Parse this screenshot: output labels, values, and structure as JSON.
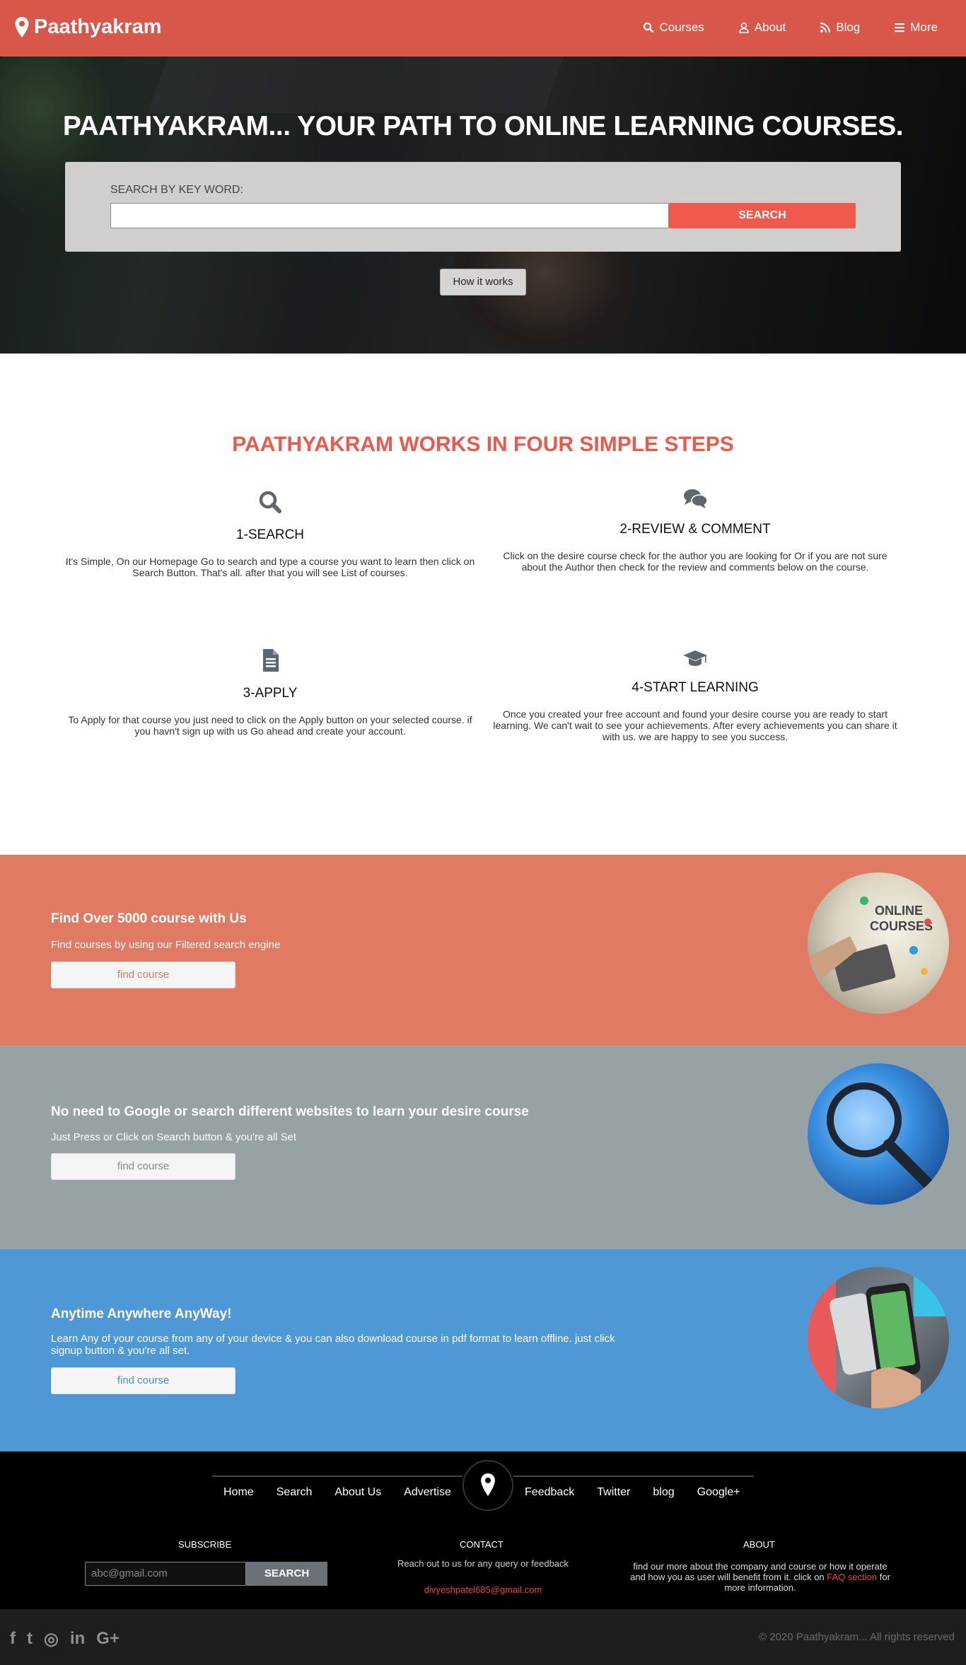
{
  "navbar": {
    "brand": "Paathyakram",
    "items": [
      {
        "label": "Courses",
        "icon": "search-icon"
      },
      {
        "label": "About",
        "icon": "user-icon"
      },
      {
        "label": "Blog",
        "icon": "rss-icon"
      },
      {
        "label": "More",
        "icon": "menu-icon"
      }
    ]
  },
  "hero": {
    "title": "PAATHYAKRAM... YOUR PATH TO ONLINE LEARNING COURSES.",
    "search_label": "SEARCH BY KEY WORD:",
    "search_value": "",
    "search_button": "SEARCH",
    "how_button": "How it works"
  },
  "steps": {
    "title": "PAATHYAKRAM WORKS IN FOUR SIMPLE STEPS",
    "items": [
      {
        "icon": "search-icon",
        "title": "1-SEARCH",
        "text": "It's Simple, On our Homepage Go to search and type a course you want to learn then click on Search Button. That's all. after that you will see List of courses."
      },
      {
        "icon": "comments-icon",
        "title": "2-REVIEW & COMMENT",
        "text": "Click on the desire course check for the author you are looking for Or if you are not sure about the Author then check for the review and comments below on the course."
      },
      {
        "icon": "document-icon",
        "title": "3-APPLY",
        "text": "To Apply for that course you just need to click on the Apply button on your selected course. if you havn't sign up with us Go ahead and create your account."
      },
      {
        "icon": "graduation-cap-icon",
        "title": "4-START LEARNING",
        "text": "Once you created your free account and found your desire course you are ready to start learning. We can't wait to see your achievements. After every achievements you can share it with us. we are happy to see you success."
      }
    ]
  },
  "bands": [
    {
      "title": "Find Over 5000 course with Us",
      "text": "Find courses by using our Filtered search engine",
      "button": "find course",
      "color": "#e07a62",
      "button_color": "#e07a62"
    },
    {
      "title": "No need to Google or search different websites to learn your desire course",
      "text": "Just Press or Click on Search button & you're all Set",
      "button": "find course",
      "color": "#96a2a3",
      "button_color": "#8a8a8a"
    },
    {
      "title": "Anytime Anywhere AnyWay!",
      "text": "Learn Any of your course from any of your device & you can also download course in pdf format to learn offline. just click signup button & you're all set.",
      "button": "find course",
      "color": "#4e98d6",
      "button_color": "#4e8fcb"
    }
  ],
  "footer": {
    "nav_left": [
      "Home",
      "Search",
      "About Us",
      "Advertise"
    ],
    "nav_right": [
      "Feedback",
      "Twitter",
      "blog",
      "Google+"
    ],
    "subscribe_title": "SUBSCRIBE",
    "subscribe_placeholder": "abc@gmail.com",
    "subscribe_button": "SEARCH",
    "contact_title": "CONTACT",
    "contact_text": "Reach out to us for any query or feedback",
    "contact_email": "divyeshpatel685@gmail.com",
    "about_title": "ABOUT",
    "about_text_before": "find our more about the company and course or how it operate and how you as user will benefit from it. click on",
    "about_link": "FAQ section",
    "about_text_after": "for more information.",
    "social": [
      "f",
      "t",
      "◎",
      "in",
      "G+"
    ],
    "copyright": "© 2020 Paathyakram... All rights reserved"
  }
}
